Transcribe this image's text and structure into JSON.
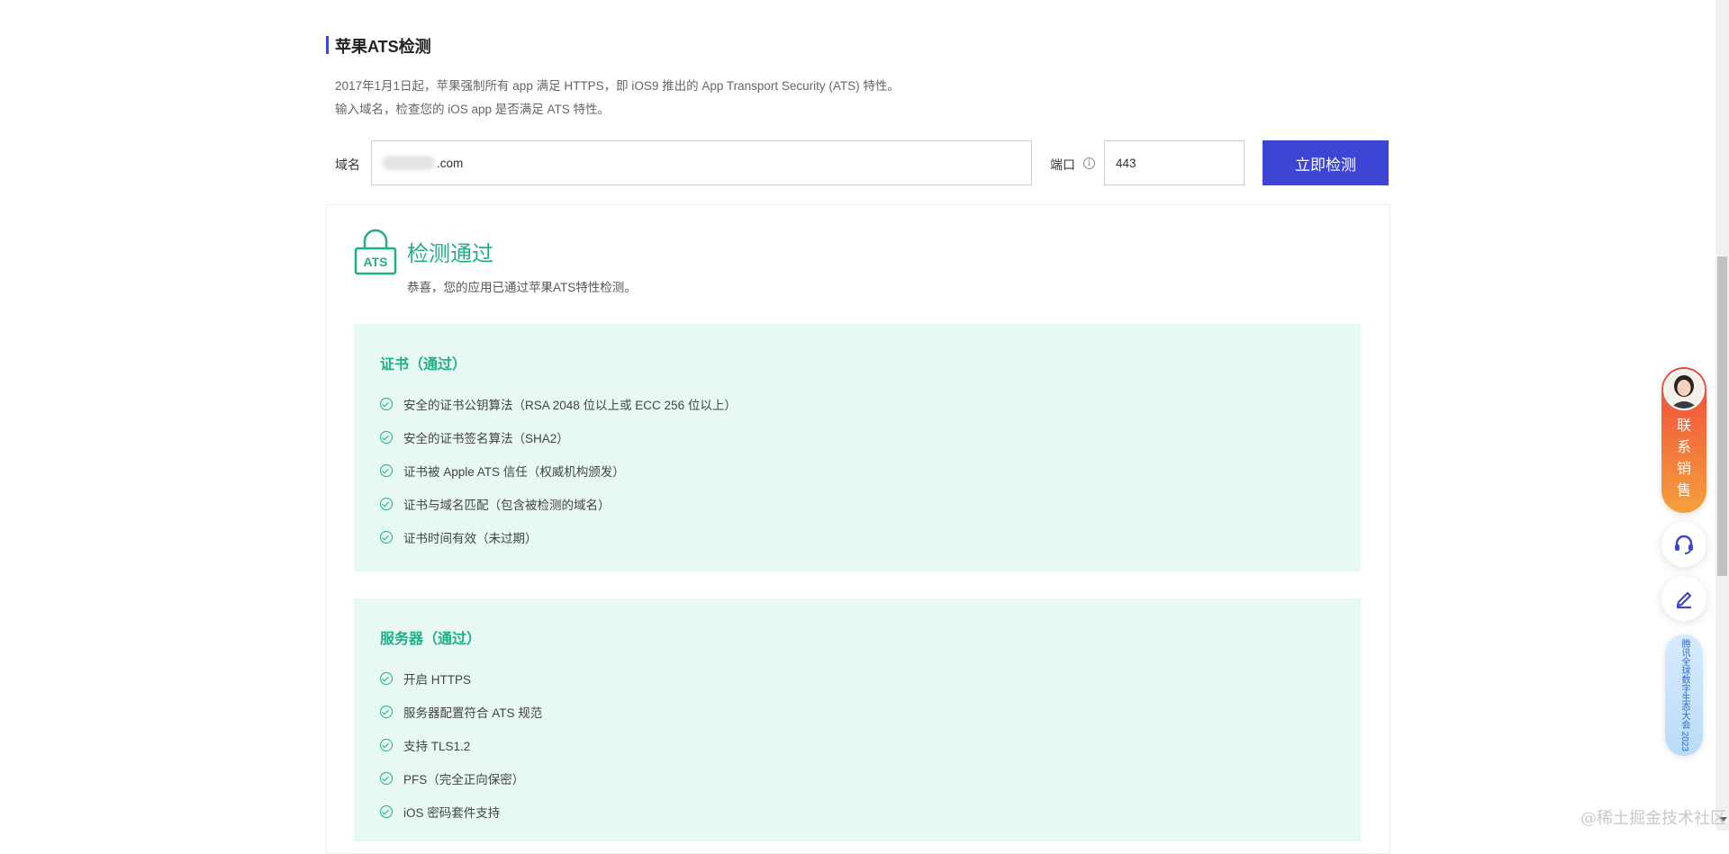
{
  "header": {
    "title": "苹果ATS检测",
    "desc_line1": "2017年1月1日起，苹果强制所有 app 满足 HTTPS，即 iOS9 推出的 App Transport Security (ATS) 特性。",
    "desc_line2": "输入域名，检查您的 iOS app 是否满足 ATS 特性。"
  },
  "form": {
    "domain_label": "域名",
    "domain_value": ".com",
    "port_label": "端口",
    "port_value": "443",
    "submit_label": "立即检测"
  },
  "result": {
    "icon_text": "ATS",
    "title": "检测通过",
    "subtitle": "恭喜，您的应用已通过苹果ATS特性检测。",
    "accent_color": "#1fb08a",
    "sections": [
      {
        "title": "证书（通过）",
        "items": [
          "安全的证书公钥算法（RSA 2048 位以上或 ECC 256 位以上）",
          "安全的证书签名算法（SHA2）",
          "证书被 Apple ATS 信任（权威机构颁发）",
          "证书与域名匹配（包含被检测的域名）",
          "证书时间有效（未过期）"
        ]
      },
      {
        "title": "服务器（通过）",
        "items": [
          "开启 HTTPS",
          "服务器配置符合 ATS 规范",
          "支持 TLS1.2",
          "PFS（完全正向保密）",
          "iOS 密码套件支持"
        ]
      }
    ]
  },
  "sidebar": {
    "sales_label": "联系销售",
    "support_icon": "headset-icon",
    "edit_icon": "edit-icon",
    "promo_text": "腾讯全球数字生态大会 2023"
  },
  "watermark": "@稀土掘金技术社区"
}
